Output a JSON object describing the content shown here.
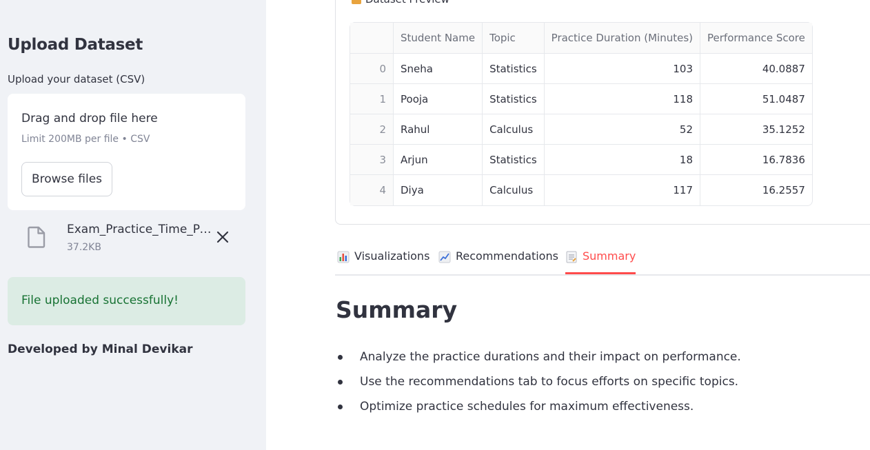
{
  "sidebar": {
    "title": "Upload Dataset",
    "upload_label": "Upload your dataset (CSV)",
    "dropzone": {
      "main_text": "Drag and drop file here",
      "sub_text": "Limit 200MB per file • CSV",
      "browse_label": "Browse files"
    },
    "file": {
      "name": "Exam_Practice_Time_Performance.csv",
      "size": "37.2KB"
    },
    "success_message": "File uploaded successfully!",
    "credit": "Developed by Minal Devikar"
  },
  "main": {
    "preview_label": "Dataset Preview",
    "table": {
      "headers": [
        "",
        "Student Name",
        "Topic",
        "Practice Duration (Minutes)",
        "Performance Score"
      ],
      "rows": [
        [
          "0",
          "Sneha",
          "Statistics",
          "103",
          "40.0887"
        ],
        [
          "1",
          "Pooja",
          "Statistics",
          "118",
          "51.0487"
        ],
        [
          "2",
          "Rahul",
          "Calculus",
          "52",
          "35.1252"
        ],
        [
          "3",
          "Arjun",
          "Statistics",
          "18",
          "16.7836"
        ],
        [
          "4",
          "Diya",
          "Calculus",
          "117",
          "16.2557"
        ]
      ]
    },
    "tabs": [
      {
        "label": "Visualizations",
        "icon": "bar-chart-icon"
      },
      {
        "label": "Recommendations",
        "icon": "trending-chart-icon"
      },
      {
        "label": "Summary",
        "icon": "memo-icon",
        "active": true
      }
    ],
    "summary": {
      "title": "Summary",
      "points": [
        "Analyze the practice durations and their impact on performance.",
        "Use the recommendations tab to focus efforts on specific topics.",
        "Optimize practice schedules for maximum effectiveness."
      ]
    }
  },
  "colors": {
    "accent": "#ff4b4b",
    "sidebar_bg": "#f0f2f6",
    "success_bg": "#dcece4",
    "success_text": "#177233"
  }
}
